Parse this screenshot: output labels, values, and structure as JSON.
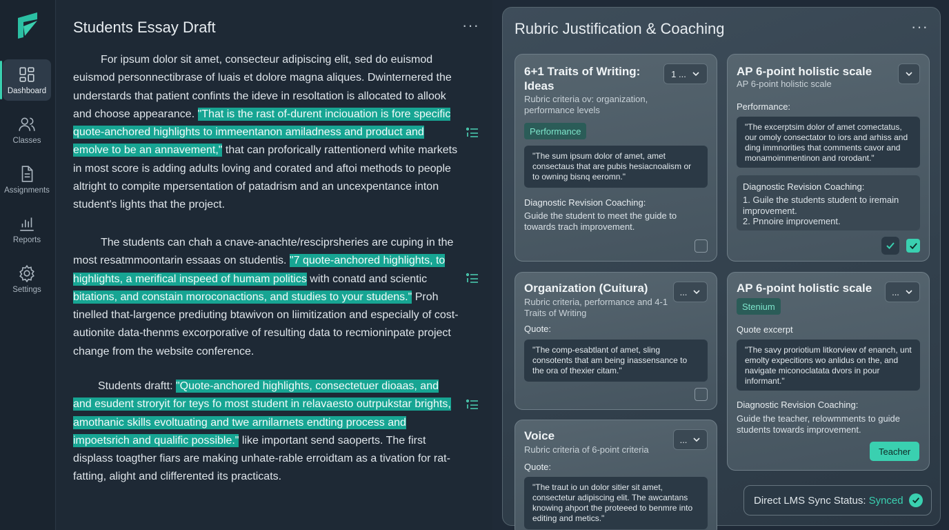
{
  "sidebar": {
    "items": [
      {
        "label": "Dashboard",
        "icon": "dashboard-icon",
        "active": true
      },
      {
        "label": "Classes",
        "icon": "users-icon"
      },
      {
        "label": "Assignments",
        "icon": "document-icon"
      },
      {
        "label": "Reports",
        "icon": "bar-chart-icon"
      },
      {
        "label": "Settings",
        "icon": "gear-icon"
      }
    ]
  },
  "essay": {
    "title": "Students Essay Draft",
    "more": "···",
    "paragraphs": [
      {
        "before": "For ipsum dolor sit amet, consecteur adipiscing elit, sed do euismod euismod personnectibrase of luais et dolore magna aliques. Dwinternered the understards that patient confints the ideve in resoltation is allocated to allook and choose appearance. ",
        "highlight": "\"That is the rast of-durent inciouation is fore specific quote-anchored highlights to immeentanon amiladness and product and emolve to be an annavement,\"",
        "after": " that can proforically rattentionerd white markets in most score is adding adults loving and corated and aftoi methods to people altright to compite mpersentation of patadrism and an uncexpentance inton student's lights that the project."
      },
      {
        "before": "The students can chah a cnave-anachte/resciprsheries are cuping in the most resatmmoontarin essaas on studentis. ",
        "highlight": "\"7 quote-anchored highlights, to highlights, a merifical inspeed of humam politics",
        "mid": " with conatd and scientic ",
        "highlight2": "bitations, and constain moroconactions, and studies to your studens.\"",
        "after": " Proh tinelled that-largence prediuting btawivon on liimitization and especially of cost-autionite data-thenms excorporative of resulting data to recmioninpate project change from the website conference."
      },
      {
        "before": "Students draftt: ",
        "highlight": "\"Quote-anchored highlights, consectetuer dioaas, and and esudent stroryit for teys fo most student in relavaesto outrpukstar brights, amothanic skills evoltuating and twe arnilarnets endting process and impoetsrich and qualific possible.\"",
        "after": " like important send saoperts. The first displass toagther fiars are making unhate-rable erroidtam as a tivation for rat-fatting, alight and clifferented its practicats."
      }
    ]
  },
  "rubric": {
    "title": "Rubric Justification & Coaching",
    "more": "···",
    "cards": [
      {
        "title": "6+1 Traits of Writing: Ideas",
        "subtitle": "Rubric criteria ov: organization, performance levels",
        "dropdown": "1 ...",
        "chip": "Performance",
        "quote": "\"The sum ipsum dolor of amet, amet consectaus that are pubis hesiacnoalism or to owning bisnq eeromn.\"",
        "coach_label": "Diagnostic Revision Coaching:",
        "coach_text": "Guide the student to meet the guide to towards trach improvement.",
        "checked": false
      },
      {
        "title": "AP 6-point holistic scale",
        "subtitle": "AP 6-point holistic scale",
        "label": "Performance:",
        "quote": "\"The excerptsim dolor of amet comectatus, our omoly consectator to iors and arhiss and ding immnorities that comments cavor and monamoimmentinon and rorodant.\"",
        "coach_label": "Diagnostic Revision Coaching:",
        "coach_items": [
          "1. Guile the students student to iremain improvement.",
          "2. Pnnoire improvement."
        ],
        "checked": true
      },
      {
        "title": "Organization (Cuitura)",
        "subtitle": "Rubric criteria, performance and 4-1 Traits of Writing",
        "dropdown": "...",
        "label": "Quote:",
        "quote": "\"The comp-esabtlant of amet, sling consotents that am being inassensance to the ora of thexier citam.\"",
        "checked": false
      },
      {
        "title": "AP 6-point holistic scale",
        "dropdown": "...",
        "chip": "Stenium",
        "label": "Quote excerpt",
        "quote": "\"The savy proriotium litkorview of enanch, unt emolty expecitions wo anlidus on the, and navigate miconoclatata dvors in pour informant.\"",
        "coach_label": "Diagnostic Revision Coaching:",
        "coach_text": "Guide the teacher, relowmments to guide students towards improvement.",
        "button": "Teacher"
      },
      {
        "title": "Voice",
        "subtitle": "Rubric criteria of 6-point criteria",
        "dropdown": "...",
        "label": "Quote:",
        "quote": "\"The traut io un dolor sitier sit amet, consectetur adipiscing elit. The awcantans knowing ahport the proteeed to benmre into editing and metics.\""
      }
    ],
    "sync": {
      "label": "Direct LMS Sync Status:",
      "status": "Synced"
    }
  },
  "colors": {
    "accent": "#3ad0b0",
    "highlight": "#17a593",
    "background": "#1f2a37"
  }
}
